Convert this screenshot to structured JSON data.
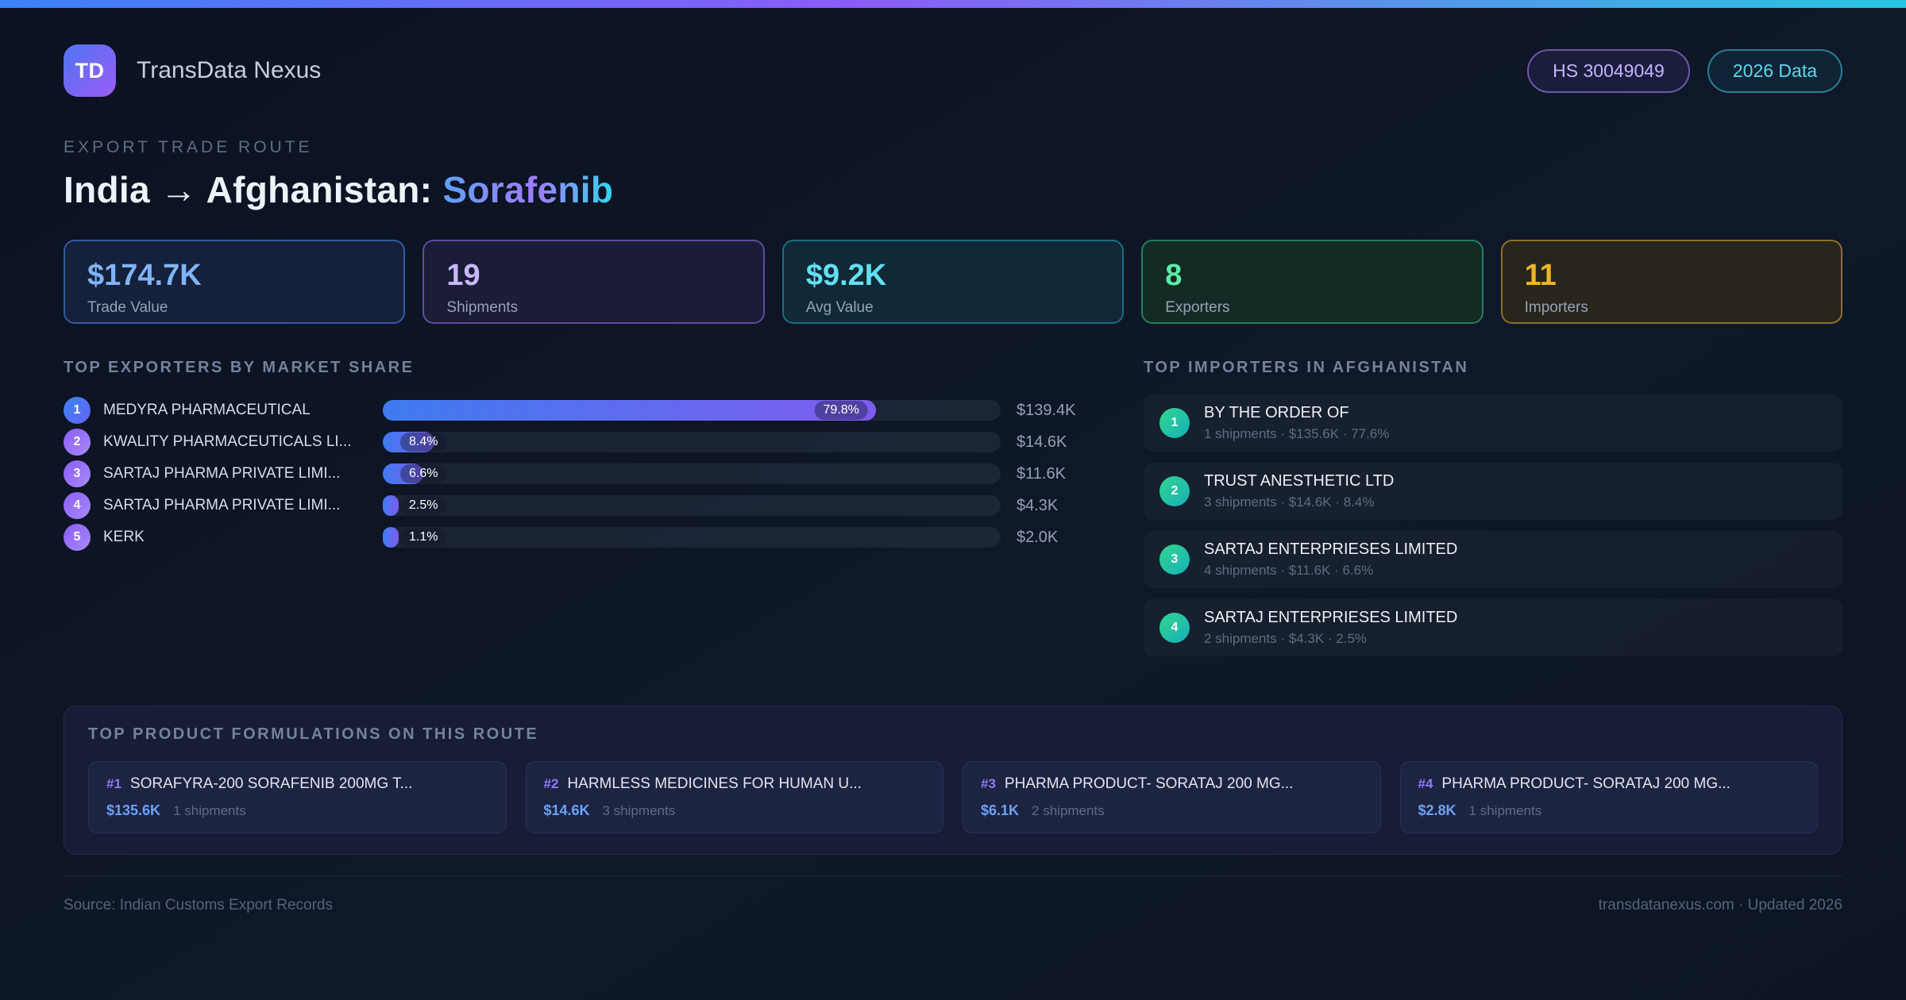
{
  "header": {
    "logo_text": "TD",
    "brand": "TransData Nexus",
    "badges": [
      {
        "label": "HS 30049049",
        "style": "purple"
      },
      {
        "label": "2026 Data",
        "style": "cyan"
      }
    ]
  },
  "hero": {
    "eyebrow": "EXPORT TRADE ROUTE",
    "title_main": "India → Afghanistan: ",
    "title_highlight": "Sorafenib"
  },
  "stats": [
    {
      "value": "$174.7K",
      "label": "Trade Value",
      "style": "blue"
    },
    {
      "value": "19",
      "label": "Shipments",
      "style": "purple"
    },
    {
      "value": "$9.2K",
      "label": "Avg Value",
      "style": "cyan"
    },
    {
      "value": "8",
      "label": "Exporters",
      "style": "green"
    },
    {
      "value": "11",
      "label": "Importers",
      "style": "amber"
    }
  ],
  "exporters": {
    "heading": "TOP EXPORTERS BY MARKET SHARE",
    "rows": [
      {
        "rank": "1",
        "name": "MEDYRA PHARMACEUTICAL",
        "pct": 79.8,
        "pct_label": "79.8%",
        "value": "$139.4K"
      },
      {
        "rank": "2",
        "name": "KWALITY PHARMACEUTICALS LI...",
        "pct": 8.4,
        "pct_label": "8.4%",
        "value": "$14.6K"
      },
      {
        "rank": "3",
        "name": "SARTAJ PHARMA PRIVATE LIMI...",
        "pct": 6.6,
        "pct_label": "6.6%",
        "value": "$11.6K"
      },
      {
        "rank": "4",
        "name": "SARTAJ PHARMA PRIVATE LIMI...",
        "pct": 2.5,
        "pct_label": "2.5%",
        "value": "$4.3K"
      },
      {
        "rank": "5",
        "name": "KERK",
        "pct": 1.1,
        "pct_label": "1.1%",
        "value": "$2.0K"
      }
    ]
  },
  "importers": {
    "heading": "TOP IMPORTERS IN AFGHANISTAN",
    "rows": [
      {
        "rank": "1",
        "name": "BY THE ORDER OF",
        "meta": "1 shipments · $135.6K · 77.6%"
      },
      {
        "rank": "2",
        "name": "TRUST ANESTHETIC LTD",
        "meta": "3 shipments · $14.6K · 8.4%"
      },
      {
        "rank": "3",
        "name": "SARTAJ ENTERPRIESES LIMITED",
        "meta": "4 shipments · $11.6K · 6.6%"
      },
      {
        "rank": "4",
        "name": "SARTAJ ENTERPRIESES LIMITED",
        "meta": "2 shipments · $4.3K · 2.5%"
      }
    ]
  },
  "products": {
    "heading": "TOP PRODUCT FORMULATIONS ON THIS ROUTE",
    "cards": [
      {
        "rank": "#1",
        "name": "SORAFYRA-200 SORAFENIB 200MG T...",
        "value": "$135.6K",
        "shipments": "1 shipments"
      },
      {
        "rank": "#2",
        "name": "HARMLESS MEDICINES FOR HUMAN U...",
        "value": "$14.6K",
        "shipments": "3 shipments"
      },
      {
        "rank": "#3",
        "name": "PHARMA PRODUCT- SORATAJ 200 MG...",
        "value": "$6.1K",
        "shipments": "2 shipments"
      },
      {
        "rank": "#4",
        "name": "PHARMA PRODUCT- SORATAJ 200 MG...",
        "value": "$2.8K",
        "shipments": "1 shipments"
      }
    ]
  },
  "footer": {
    "source": "Source: Indian Customs Export Records",
    "site": "transdatanexus.com · Updated 2026"
  },
  "colors": {
    "accent_gradient": [
      "#3b82f6",
      "#8b5cf6",
      "#26c6e0"
    ],
    "bar_fill_gradient": [
      "#3f7bf0",
      "#7e5cf0"
    ],
    "stat_blue": "#80b3f9",
    "stat_purple": "#c7b8fb",
    "stat_cyan": "#62e0f2",
    "stat_green": "#5eeaa8",
    "stat_amber": "#f0b429"
  },
  "chart_data": {
    "type": "bar",
    "orientation": "horizontal",
    "title": "TOP EXPORTERS BY MARKET SHARE",
    "categories": [
      "MEDYRA PHARMACEUTICAL",
      "KWALITY PHARMACEUTICALS LI...",
      "SARTAJ PHARMA PRIVATE LIMI...",
      "SARTAJ PHARMA PRIVATE LIMI...",
      "KERK"
    ],
    "series": [
      {
        "name": "Market share %",
        "values": [
          79.8,
          8.4,
          6.6,
          2.5,
          1.1
        ]
      }
    ],
    "value_labels": [
      "$139.4K",
      "$14.6K",
      "$11.6K",
      "$4.3K",
      "$2.0K"
    ],
    "xlabel": "",
    "ylabel": "",
    "xlim": [
      0,
      100
    ],
    "grid": false,
    "legend": false
  }
}
